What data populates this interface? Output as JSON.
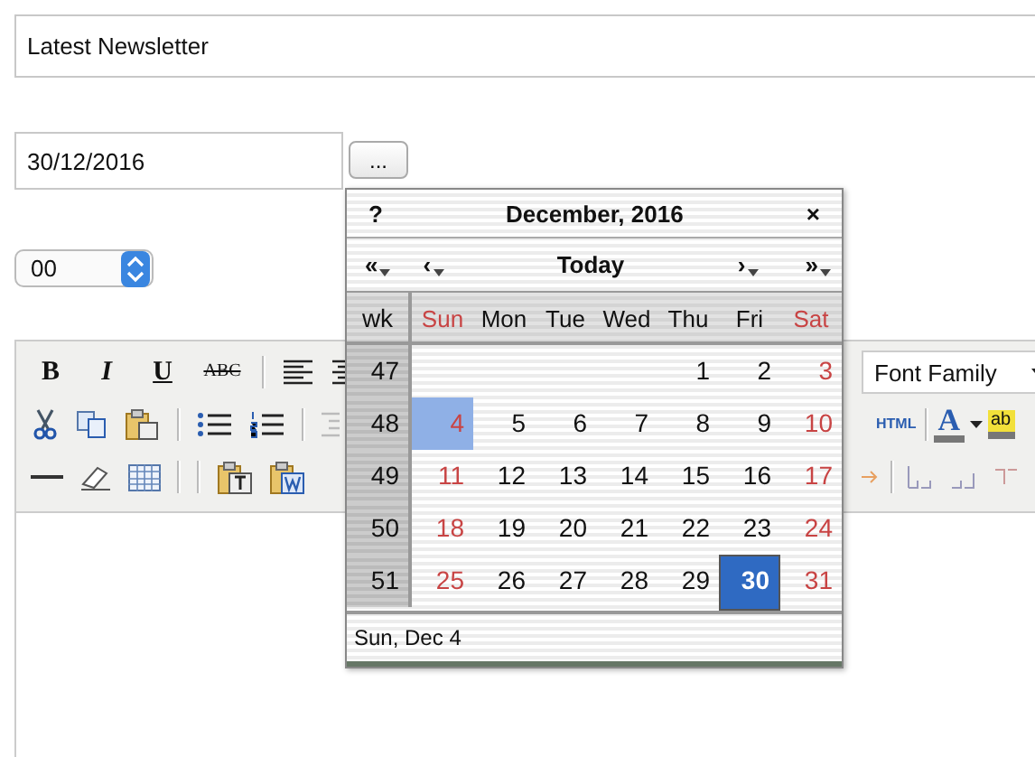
{
  "title_field": {
    "value": "Latest Newsletter"
  },
  "date_field": {
    "value": "30/12/2016"
  },
  "picker_button": {
    "label": "..."
  },
  "time_select": {
    "value": "00"
  },
  "toolbar": {
    "bold": "B",
    "italic": "I",
    "underline": "U",
    "strikethrough": "ABC",
    "font_family": "Font Family",
    "html": "HTML",
    "text_color": "A",
    "highlight": "ab"
  },
  "calendar": {
    "help": "?",
    "title": "December, 2016",
    "close": "×",
    "nav": [
      {
        "label": "«",
        "kind": "prev-year"
      },
      {
        "label": "‹",
        "kind": "prev-month"
      },
      {
        "label": "Today",
        "kind": "today"
      },
      {
        "label": "›",
        "kind": "next-month"
      },
      {
        "label": "»",
        "kind": "next-year"
      }
    ],
    "week_header": "wk",
    "weekdays": [
      {
        "label": "Sun",
        "weekend": true
      },
      {
        "label": "Mon",
        "weekend": false
      },
      {
        "label": "Tue",
        "weekend": false
      },
      {
        "label": "Wed",
        "weekend": false
      },
      {
        "label": "Thu",
        "weekend": false
      },
      {
        "label": "Fri",
        "weekend": false
      },
      {
        "label": "Sat",
        "weekend": true
      }
    ],
    "weeks": [
      {
        "number": "47",
        "days": [
          {
            "kind": "blank"
          },
          {
            "kind": "blank"
          },
          {
            "kind": "blank"
          },
          {
            "kind": "blank"
          },
          {
            "kind": "day",
            "label": "1",
            "weekend": false,
            "selected": false,
            "hovered": false
          },
          {
            "kind": "day",
            "label": "2",
            "weekend": false,
            "selected": false,
            "hovered": false
          },
          {
            "kind": "day",
            "label": "3",
            "weekend": true,
            "selected": false,
            "hovered": false
          }
        ]
      },
      {
        "number": "48",
        "days": [
          {
            "kind": "day",
            "label": "4",
            "weekend": true,
            "selected": false,
            "hovered": true
          },
          {
            "kind": "day",
            "label": "5",
            "weekend": false,
            "selected": false,
            "hovered": false
          },
          {
            "kind": "day",
            "label": "6",
            "weekend": false,
            "selected": false,
            "hovered": false
          },
          {
            "kind": "day",
            "label": "7",
            "weekend": false,
            "selected": false,
            "hovered": false
          },
          {
            "kind": "day",
            "label": "8",
            "weekend": false,
            "selected": false,
            "hovered": false
          },
          {
            "kind": "day",
            "label": "9",
            "weekend": false,
            "selected": false,
            "hovered": false
          },
          {
            "kind": "day",
            "label": "10",
            "weekend": true,
            "selected": false,
            "hovered": false
          }
        ]
      },
      {
        "number": "49",
        "days": [
          {
            "kind": "day",
            "label": "11",
            "weekend": true,
            "selected": false,
            "hovered": false
          },
          {
            "kind": "day",
            "label": "12",
            "weekend": false,
            "selected": false,
            "hovered": false
          },
          {
            "kind": "day",
            "label": "13",
            "weekend": false,
            "selected": false,
            "hovered": false
          },
          {
            "kind": "day",
            "label": "14",
            "weekend": false,
            "selected": false,
            "hovered": false
          },
          {
            "kind": "day",
            "label": "15",
            "weekend": false,
            "selected": false,
            "hovered": false
          },
          {
            "kind": "day",
            "label": "16",
            "weekend": false,
            "selected": false,
            "hovered": false
          },
          {
            "kind": "day",
            "label": "17",
            "weekend": true,
            "selected": false,
            "hovered": false
          }
        ]
      },
      {
        "number": "50",
        "days": [
          {
            "kind": "day",
            "label": "18",
            "weekend": true,
            "selected": false,
            "hovered": false
          },
          {
            "kind": "day",
            "label": "19",
            "weekend": false,
            "selected": false,
            "hovered": false
          },
          {
            "kind": "day",
            "label": "20",
            "weekend": false,
            "selected": false,
            "hovered": false
          },
          {
            "kind": "day",
            "label": "21",
            "weekend": false,
            "selected": false,
            "hovered": false
          },
          {
            "kind": "day",
            "label": "22",
            "weekend": false,
            "selected": false,
            "hovered": false
          },
          {
            "kind": "day",
            "label": "23",
            "weekend": false,
            "selected": false,
            "hovered": false
          },
          {
            "kind": "day",
            "label": "24",
            "weekend": true,
            "selected": false,
            "hovered": false
          }
        ]
      },
      {
        "number": "51",
        "days": [
          {
            "kind": "day",
            "label": "25",
            "weekend": true,
            "selected": false,
            "hovered": false
          },
          {
            "kind": "day",
            "label": "26",
            "weekend": false,
            "selected": false,
            "hovered": false
          },
          {
            "kind": "day",
            "label": "27",
            "weekend": false,
            "selected": false,
            "hovered": false
          },
          {
            "kind": "day",
            "label": "28",
            "weekend": false,
            "selected": false,
            "hovered": false
          },
          {
            "kind": "day",
            "label": "29",
            "weekend": false,
            "selected": false,
            "hovered": false
          },
          {
            "kind": "day",
            "label": "30",
            "weekend": false,
            "selected": true,
            "hovered": false
          },
          {
            "kind": "day",
            "label": "31",
            "weekend": true,
            "selected": false,
            "hovered": false
          }
        ]
      }
    ],
    "status": "Sun, Dec 4"
  }
}
